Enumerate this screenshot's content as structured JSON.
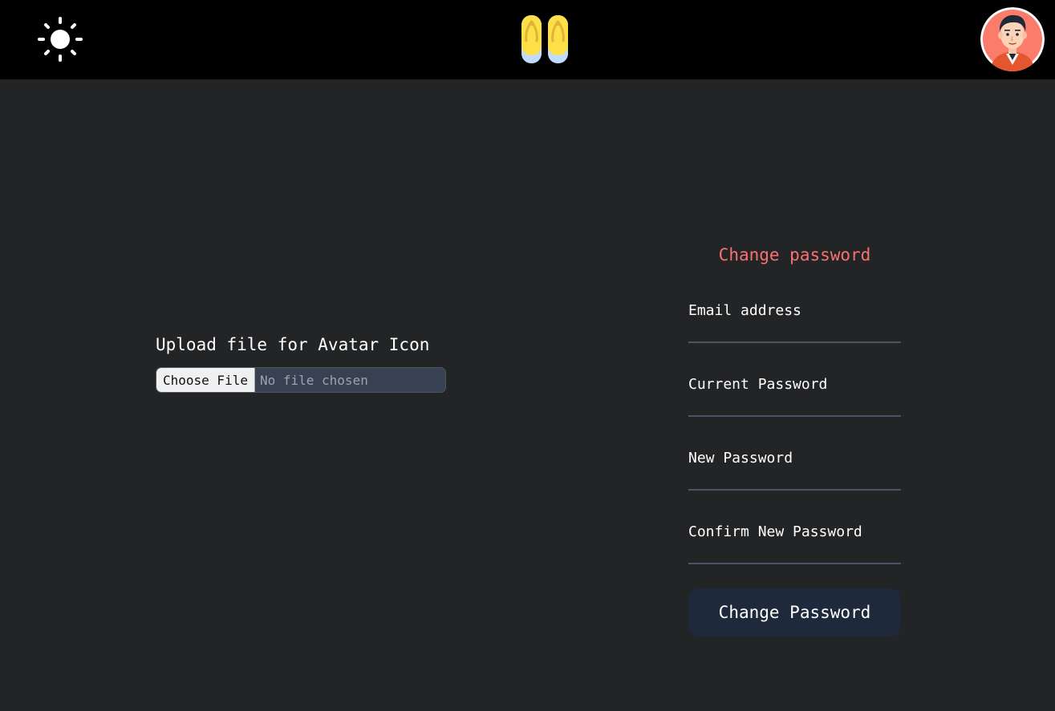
{
  "header": {
    "theme_icon": "sun-icon",
    "logo_icon": "flip-flops-icon",
    "avatar_icon": "user-avatar"
  },
  "upload": {
    "title": "Upload file for Avatar Icon",
    "button_label": "Choose File",
    "status": "No file chosen"
  },
  "password_form": {
    "title": "Change password",
    "fields": [
      {
        "label": "Email address",
        "value": ""
      },
      {
        "label": "Current Password",
        "value": ""
      },
      {
        "label": "New Password",
        "value": ""
      },
      {
        "label": "Confirm New Password",
        "value": ""
      }
    ],
    "submit_label": "Change Password"
  },
  "colors": {
    "background": "#232426",
    "header": "#000000",
    "accent_title": "#f87171",
    "button": "#1e293b",
    "input_underline": "#4b5563"
  }
}
